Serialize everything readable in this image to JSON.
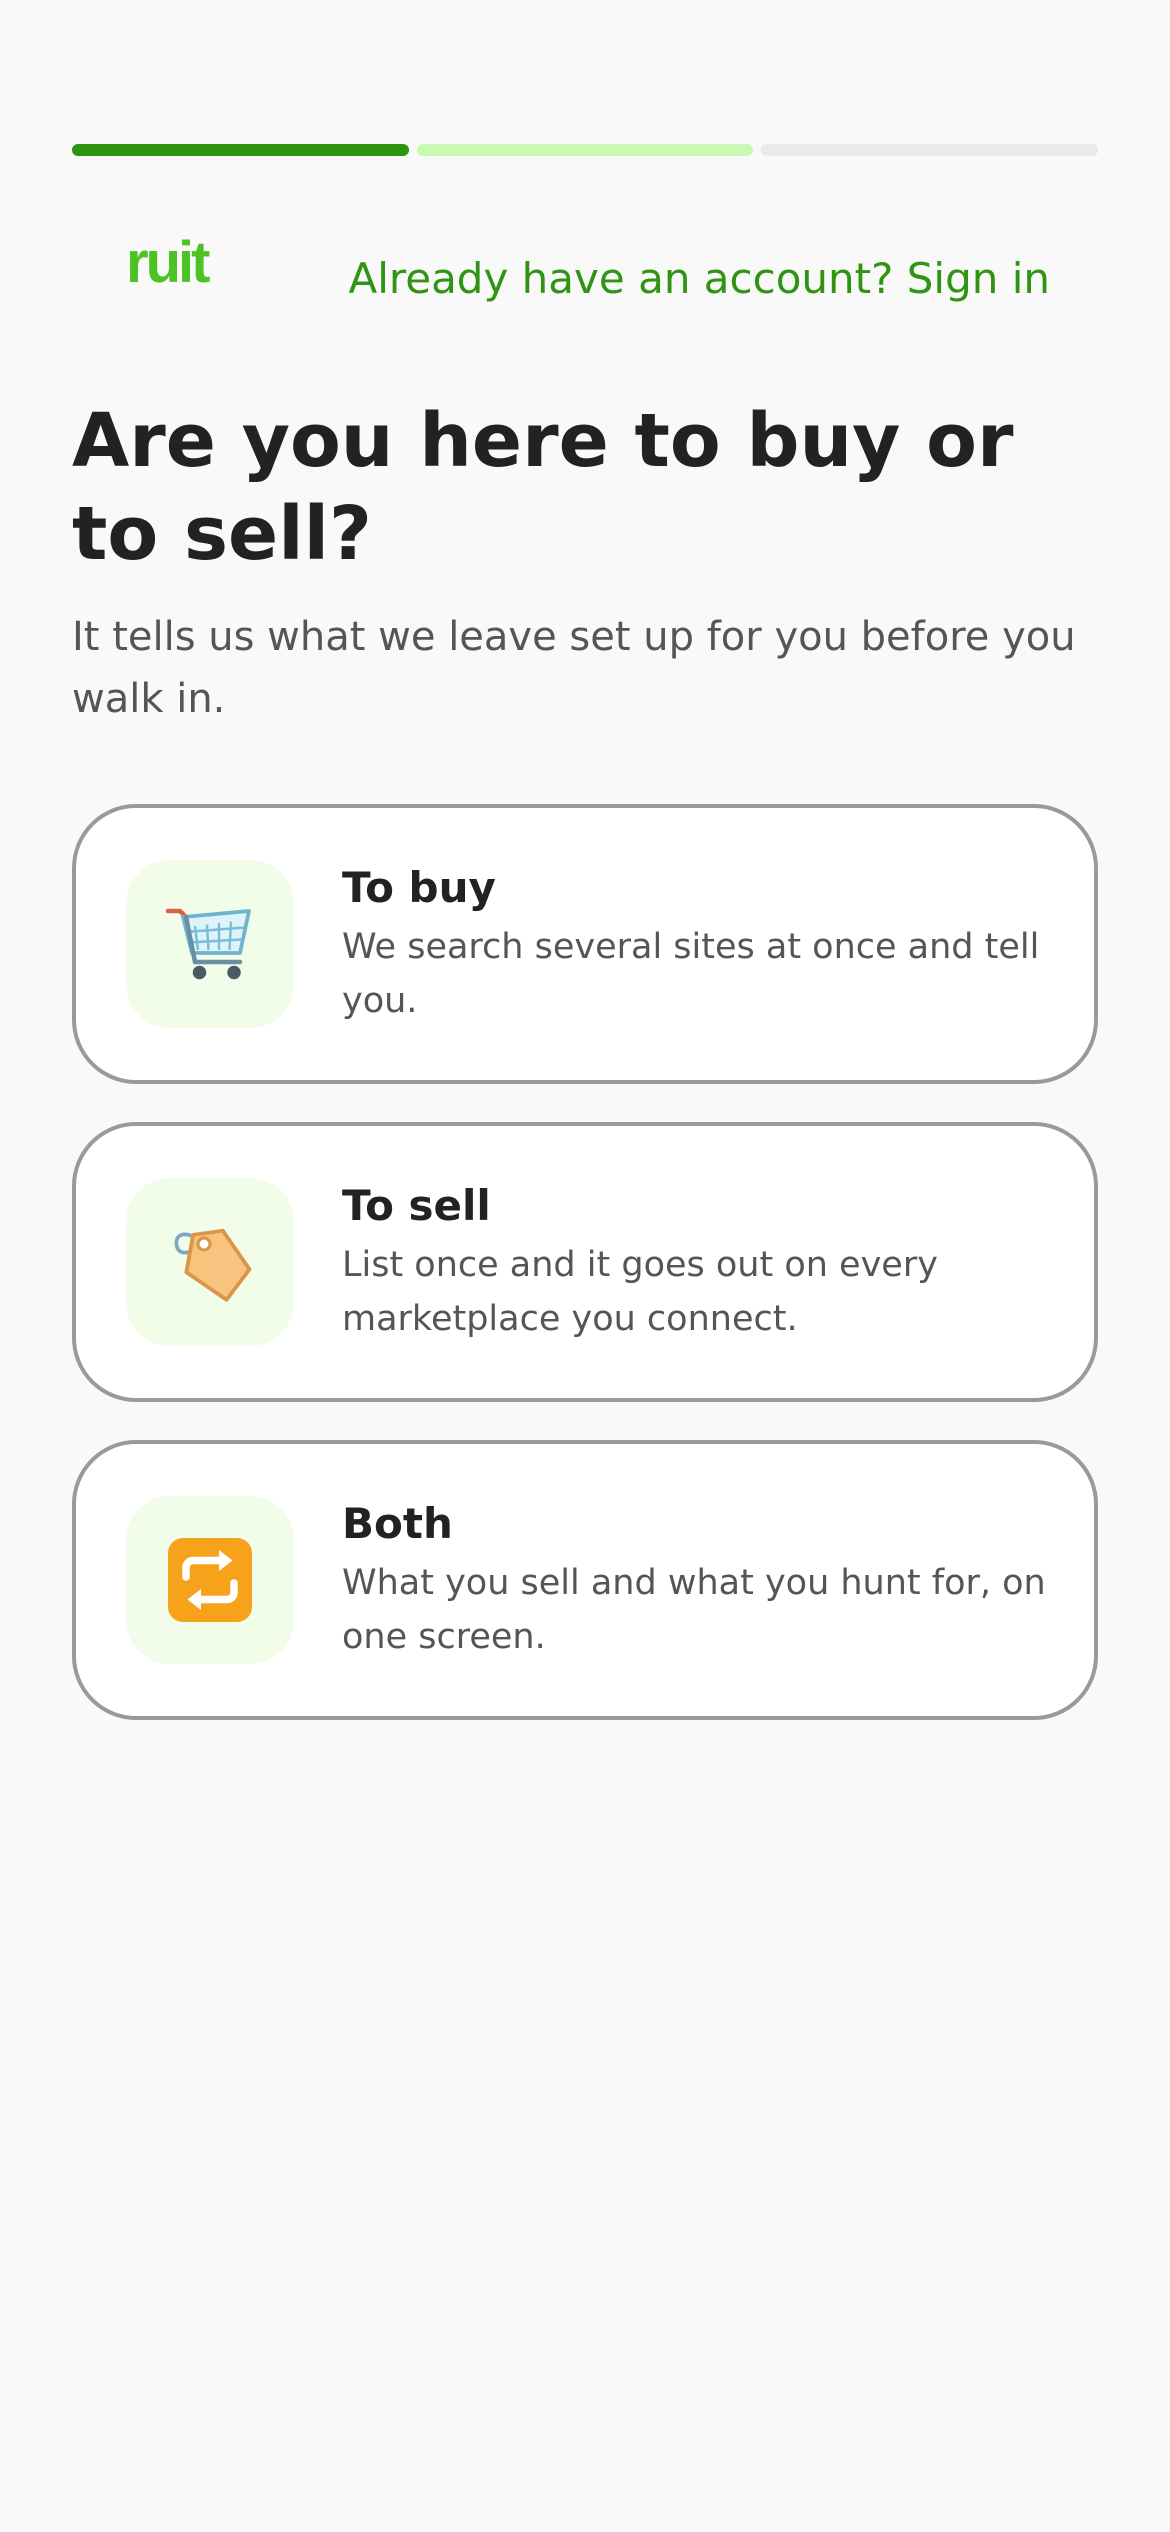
{
  "colors": {
    "progress_done": "#2e9412",
    "progress_current": "#c8fab4",
    "progress_pending": "#eaeaea",
    "brand": "#4dc225",
    "link": "#2e9412",
    "icon_bg": "#f1fde9"
  },
  "progress": {
    "total_steps": 3,
    "completed_steps": 1,
    "current_step": 2
  },
  "header": {
    "logo_text": "ruit",
    "signin_link": "Already have an account? Sign in"
  },
  "main": {
    "title": "Are you here to buy or to sell?",
    "subtitle": "It tells us what we leave set up for you before you walk in."
  },
  "options": [
    {
      "label": "To buy",
      "description": "We search several sites at once and tell you.",
      "icon": "shopping-cart-icon"
    },
    {
      "label": "To sell",
      "description": "List once and it goes out on every marketplace you connect.",
      "icon": "price-tag-icon"
    },
    {
      "label": "Both",
      "description": "What you sell and what you hunt for, on one screen.",
      "icon": "repeat-arrows-icon"
    }
  ]
}
